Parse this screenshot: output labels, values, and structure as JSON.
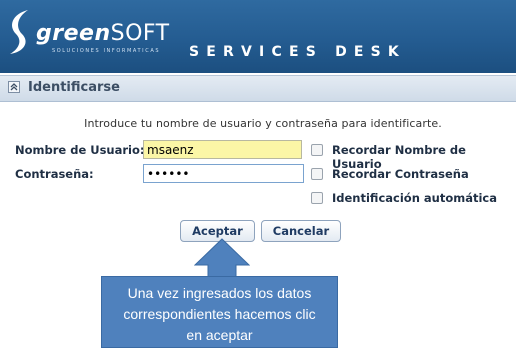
{
  "brand": {
    "logo_bold": "green",
    "logo_light": "SOFT",
    "tagline": "SOLUCIONES INFORMATICAS",
    "product": "SERVICES DESK"
  },
  "section": {
    "title": "Identificarse"
  },
  "form": {
    "intro": "Introduce tu nombre de usuario y contraseña para identificarte.",
    "username_label": "Nombre de Usuario:",
    "username_value": "msaenz",
    "password_label": "Contraseña:",
    "password_value": "••••••",
    "remember_user_label": "Recordar Nombre de Usuario",
    "remember_password_label": "Recordar Contraseña",
    "auto_login_label": "Identificación automática",
    "accept_label": "Aceptar",
    "cancel_label": "Cancelar"
  },
  "callout": {
    "line1": "Una vez ingresados los datos",
    "line2": "correspondientes hacemos clic",
    "line3": "en aceptar"
  },
  "colors": {
    "header": "#245c91",
    "callout": "#4f81bd",
    "username_bg": "#fbf6a6"
  }
}
